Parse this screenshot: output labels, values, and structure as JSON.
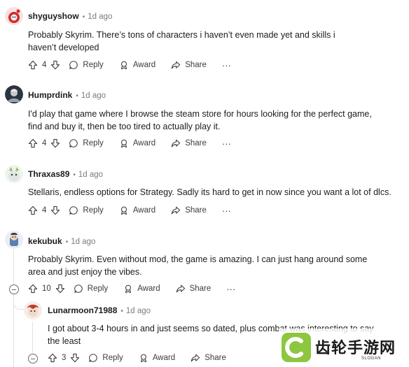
{
  "comments": [
    {
      "author": "shyguyshow",
      "age": "1d ago",
      "body": "Probably Skyrim. There’s tons of characters i haven’t even made yet and skills i haven’t developed",
      "votes": "4",
      "actions": {
        "reply": "Reply",
        "award": "Award",
        "share": "Share"
      },
      "more": "···"
    },
    {
      "author": "Humprdink",
      "age": "1d ago",
      "body": "I'd play that game where I browse the steam store for hours looking for the perfect game, find and buy it, then be too tired to actually play it.",
      "votes": "4",
      "actions": {
        "reply": "Reply",
        "award": "Award",
        "share": "Share"
      },
      "more": "···"
    },
    {
      "author": "Thraxas89",
      "age": "1d ago",
      "body": "Stellaris, endless options for Strategy. Sadly its hard to get in now since you want a lot of dlcs.",
      "votes": "4",
      "actions": {
        "reply": "Reply",
        "award": "Award",
        "share": "Share"
      },
      "more": "···"
    },
    {
      "author": "kekubuk",
      "age": "1d ago",
      "body": "Probably Skyrim. Even without mod, the game is amazing. I can just hang around some area and just enjoy the vibes.",
      "votes": "10",
      "actions": {
        "reply": "Reply",
        "award": "Award",
        "share": "Share"
      },
      "more": "···"
    },
    {
      "author": "Lunarmoon71988",
      "age": "1d ago",
      "body": "I got about 3-4 hours in and just seems so dated, plus combat was interesting to say the least",
      "votes": "3",
      "actions": {
        "reply": "Reply",
        "award": "Award",
        "share": "Share"
      },
      "more": "···"
    }
  ],
  "watermark": {
    "text": "齿轮手游网",
    "slogan": "SLOGAN"
  },
  "colors": {
    "meta": "#7c7c7c",
    "action": "#576f76",
    "text": "#1c1c1c"
  }
}
